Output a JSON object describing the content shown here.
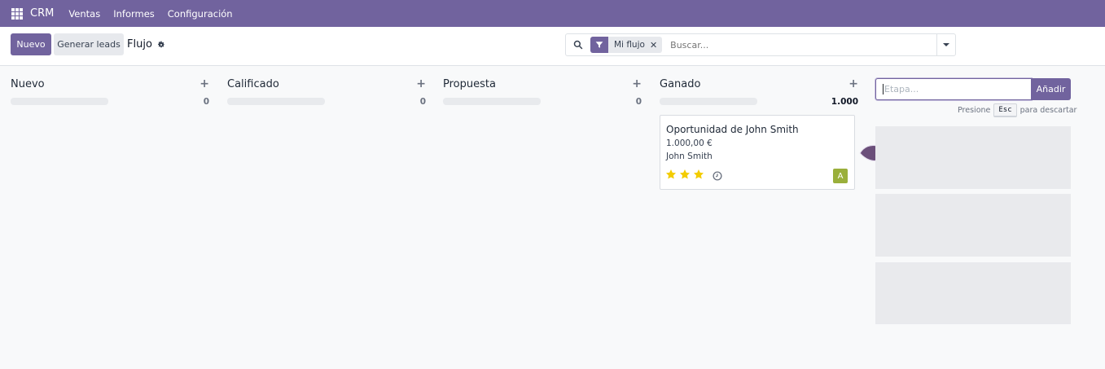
{
  "navbar": {
    "brand": "CRM",
    "menu": [
      "Ventas",
      "Informes",
      "Configuración"
    ]
  },
  "control_panel": {
    "new_button": "Nuevo",
    "generate_leads_button": "Generar leads",
    "breadcrumb": "Flujo",
    "search": {
      "facet": "Mi flujo",
      "placeholder": "Buscar..."
    }
  },
  "columns": [
    {
      "title": "Nuevo",
      "count": "0"
    },
    {
      "title": "Calificado",
      "count": "0"
    },
    {
      "title": "Propuesta",
      "count": "0"
    },
    {
      "title": "Ganado",
      "count": "1.000"
    }
  ],
  "card": {
    "title": "Oportunidad de John Smith",
    "amount": "1.000,00 €",
    "contact": "John Smith",
    "priority_stars": 3,
    "avatar_initial": "A"
  },
  "new_stage": {
    "placeholder": "Etapa...",
    "add_button": "Añadir",
    "hint_prefix": "Presione",
    "hint_key": "Esc",
    "hint_suffix": "para descartar"
  },
  "colors": {
    "brand": "#71639e",
    "star": "#f3cc00",
    "avatar": "#9aaf3b"
  }
}
